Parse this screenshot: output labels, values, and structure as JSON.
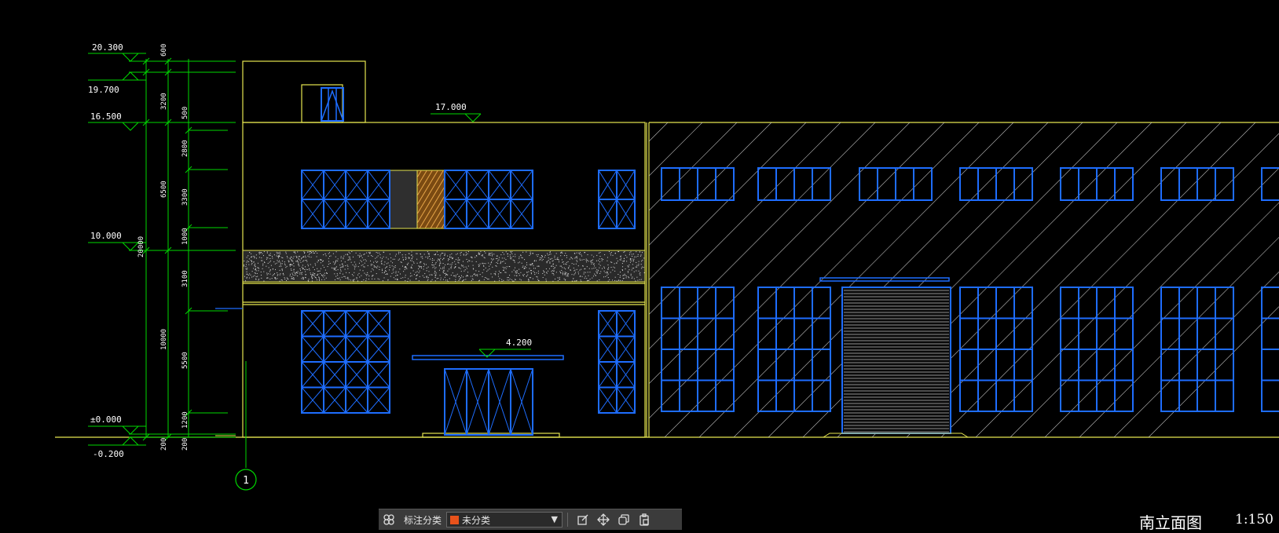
{
  "drawing": {
    "elevations": [
      {
        "label": "20.300",
        "kind": "datum"
      },
      {
        "label": "19.700",
        "kind": "datum"
      },
      {
        "label": "16.500",
        "kind": "datum"
      },
      {
        "label": "17.000",
        "kind": "roof"
      },
      {
        "label": "10.000",
        "kind": "datum"
      },
      {
        "label": "4.200",
        "kind": "canopy"
      },
      {
        "label": "±0.000",
        "kind": "datum"
      },
      {
        "label": "-0.200",
        "kind": "datum"
      }
    ],
    "dimensions": {
      "inner": [
        "600",
        "3200",
        "500",
        "2800",
        "3300",
        "1000",
        "3100",
        "5500",
        "1200",
        "200"
      ],
      "outer": [
        "6500",
        "20000",
        "10000",
        "200"
      ]
    },
    "grid_axis": "1",
    "view_title": "南立面图",
    "view_scale": "1:150"
  },
  "toolbar": {
    "label": "标注分类",
    "select_value": "未分类",
    "select_swatch": "#e8521b"
  },
  "colors": {
    "building_line": "#e6e650",
    "window_frame": "#1e6dff",
    "dimension": "#00d800",
    "text": "#ffffff",
    "hatch": "#c9c9c9",
    "background": "#000000"
  }
}
